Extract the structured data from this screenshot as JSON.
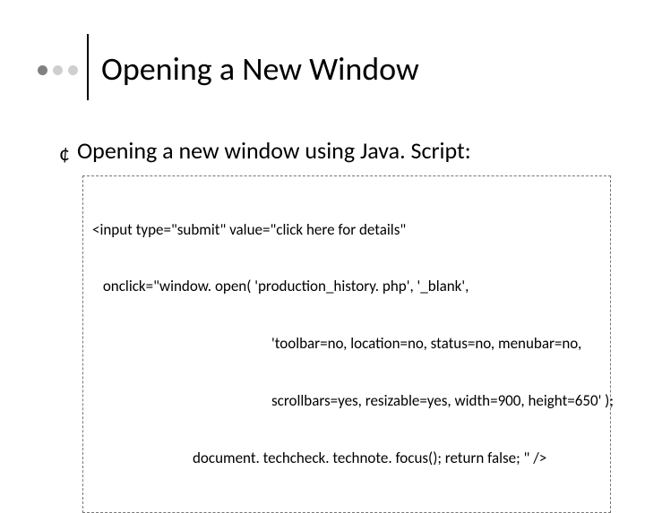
{
  "title": "Opening a New Window",
  "bullet": "Opening a new window using Java. Script:",
  "code": {
    "l1": "<input type=\"submit\" value=\"click here for details\"",
    "l2": " onclick=\"window. open( 'production_history. php', '_blank',",
    "l3": "'toolbar=no, location=no, status=no, menubar=no,",
    "l4": "scrollbars=yes, resizable=yes, width=900, height=650' );",
    "l5": "document. techcheck. technote. focus(); return false; \" />"
  }
}
